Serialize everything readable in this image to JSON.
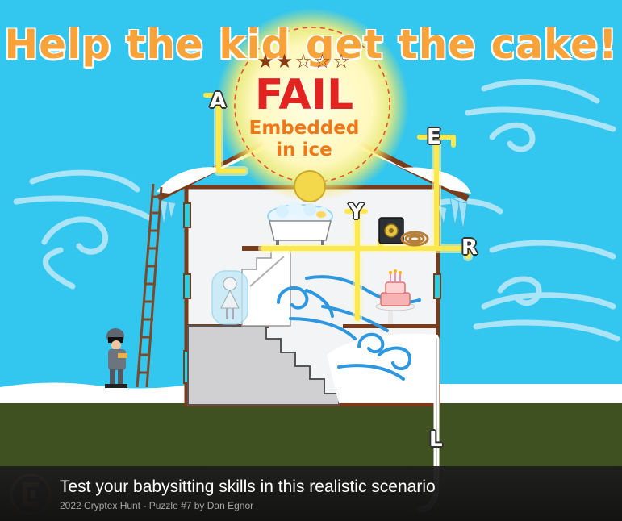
{
  "game": {
    "title": "Help the kid get the cake!",
    "result": {
      "stars_filled": 2,
      "stars_total": 5,
      "stars_text": "★★☆☆☆",
      "status": "FAIL",
      "reason": "Embedded in ice"
    },
    "pipe_letters": [
      "A",
      "E",
      "Y",
      "R",
      "L"
    ]
  },
  "caption": {
    "title": "Test your babysitting skills in this realistic scenario",
    "subtitle": "2022 Cryptex Hunt - Puzzle #7 by Dan Egnor"
  },
  "colors": {
    "sky": "#33c6ee",
    "ground": "#3f5120",
    "snow": "#ffffff",
    "pipe": "#ffe94a",
    "fail": "#e32320",
    "title": "#f7a33a",
    "caption_bg": "#1e1e1e"
  }
}
